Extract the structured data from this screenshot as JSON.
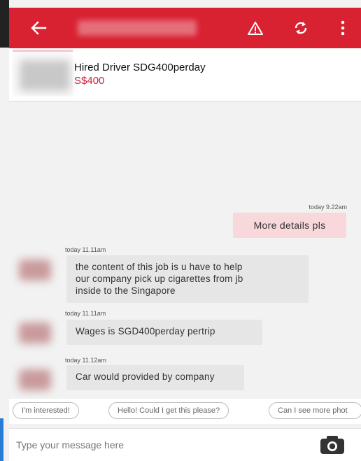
{
  "app_bar": {
    "title": "",
    "icons": [
      "back-arrow-icon",
      "warning-icon",
      "sync-icon",
      "more-vert-icon"
    ],
    "color": "#d82232"
  },
  "listing": {
    "title": "Hired Driver SDG400perday",
    "price": "S$400",
    "price_color": "#d0213a"
  },
  "messages": [
    {
      "direction": "outgoing",
      "time": "today 9.22am",
      "text": "More details pls"
    },
    {
      "direction": "incoming",
      "time": "today 11.11am",
      "lines": [
        "the content of this job is u have  to help",
        "our company pick up cigarettes from jb",
        "inside to the Singapore"
      ]
    },
    {
      "direction": "incoming",
      "time": "today 11.11am",
      "text": "Wages is SGD400perday pertrip"
    },
    {
      "direction": "incoming",
      "time": "today 11.12am",
      "text": "Car would provided by company"
    }
  ],
  "quick_replies": [
    "I'm interested!",
    "Hello! Could I get this please?",
    "Can I see more phot"
  ],
  "composer": {
    "placeholder": "Type your message here",
    "camera_icon": "camera-icon"
  }
}
